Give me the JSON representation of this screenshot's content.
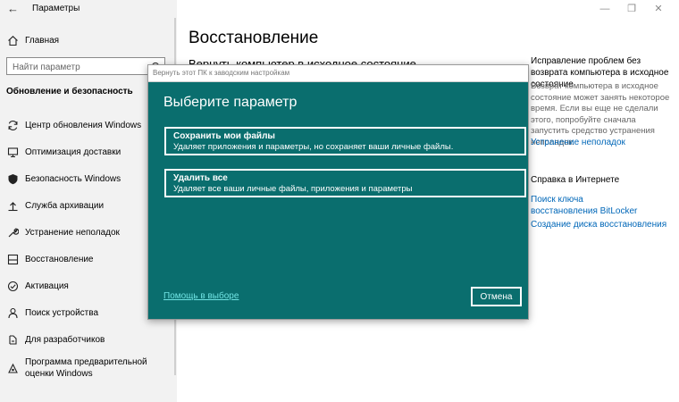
{
  "app": {
    "title": "Параметры"
  },
  "window_controls": {
    "minimize": "—",
    "maximize": "❐",
    "close": "✕"
  },
  "sidebar": {
    "home_label": "Главная",
    "search_placeholder": "Найти параметр",
    "section_title": "Обновление и безопасность",
    "items": [
      {
        "label": "Центр обновления Windows",
        "icon": "sync-icon"
      },
      {
        "label": "Оптимизация доставки",
        "icon": "delivery-icon"
      },
      {
        "label": "Безопасность Windows",
        "icon": "shield-icon"
      },
      {
        "label": "Служба архивации",
        "icon": "backup-icon"
      },
      {
        "label": "Устранение неполадок",
        "icon": "wrench-icon"
      },
      {
        "label": "Восстановление",
        "icon": "recovery-icon"
      },
      {
        "label": "Активация",
        "icon": "check-circle-icon"
      },
      {
        "label": "Поиск устройства",
        "icon": "person-search-icon"
      },
      {
        "label": "Для разработчиков",
        "icon": "developer-icon"
      },
      {
        "label": "Программа предварительной оценки Windows",
        "icon": "insider-icon"
      }
    ]
  },
  "main": {
    "page_title": "Восстановление",
    "hidden_heading": "Вернуть компьютер в исходное состояние"
  },
  "right_col": {
    "fix_heading": "Исправление проблем без возврата компьютера в исходное состояние",
    "fix_text": "Возврат компьютера в исходное состояние может занять некоторое время. Если вы еще не сделали этого, попробуйте сначала запустить средство устранения неполадок.",
    "fix_link": "Устранение неполадок",
    "web_heading": "Справка в Интернете",
    "links": [
      "Поиск ключа восстановления BitLocker",
      "Создание диска восстановления"
    ]
  },
  "dialog": {
    "title": "Вернуть этот ПК к заводским настройкам",
    "heading": "Выберите параметр",
    "options": [
      {
        "title": "Сохранить мои файлы",
        "desc": "Удаляет приложения и параметры, но сохраняет ваши личные файлы."
      },
      {
        "title": "Удалить все",
        "desc": "Удаляет все ваши личные файлы, приложения и параметры"
      }
    ],
    "help_link": "Помощь в выборе",
    "cancel": "Отмена"
  },
  "colors": {
    "dialog_bg": "#0a6e6e",
    "link": "#0067b8",
    "sidebar_bg": "#f2f2f2"
  }
}
